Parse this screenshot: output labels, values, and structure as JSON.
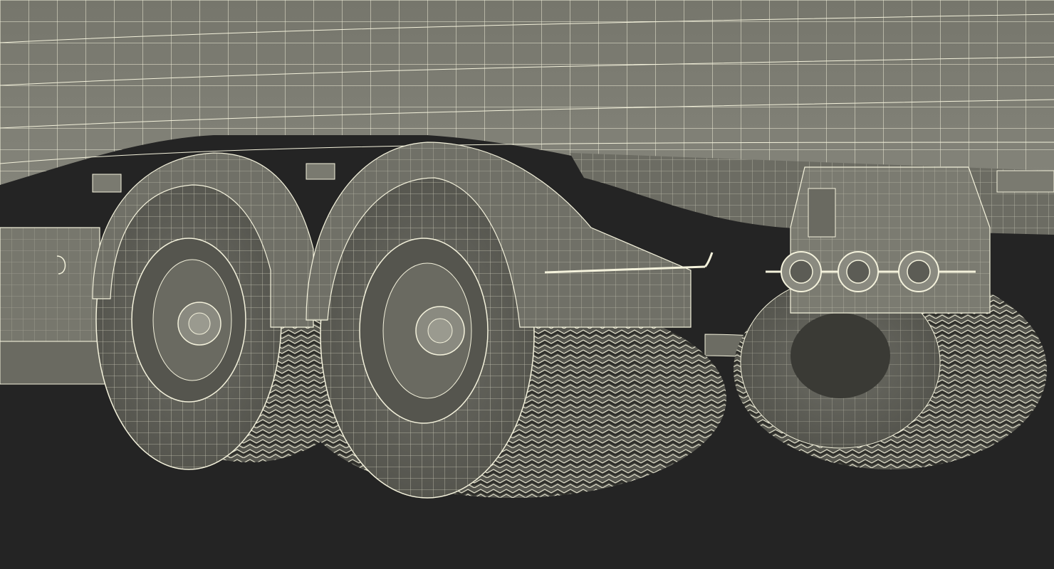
{
  "scene": {
    "subject": "wireframe-truck-trailer-wheels",
    "colors": {
      "background": "#242424",
      "surface": "#7a7a70",
      "surface_dark": "#5e5e56",
      "surface_shadow": "#4a4a44",
      "wire": "#f4f2dc",
      "tire": "#55554e",
      "tread": "#3a3a35"
    },
    "parts": {
      "tank_body": "tank-body",
      "fenders": [
        "fender-front",
        "fender-middle"
      ],
      "wheels": [
        "wheel-front",
        "wheel-middle",
        "wheel-rear"
      ],
      "lights": [
        "tail-light-1",
        "tail-light-2",
        "tail-light-3"
      ],
      "frame": "chassis-frame",
      "side_box": "side-toolbox"
    }
  }
}
